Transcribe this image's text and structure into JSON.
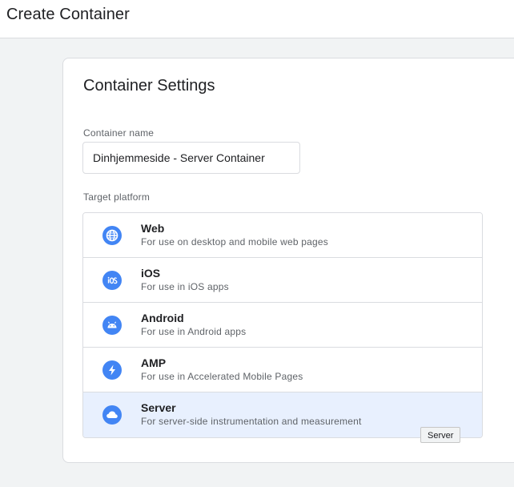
{
  "header": {
    "title": "Create Container"
  },
  "card": {
    "title": "Container Settings",
    "container_name_label": "Container name",
    "container_name_value": "Dinhjemmeside - Server Container",
    "target_platform_label": "Target platform"
  },
  "platforms": [
    {
      "name": "Web",
      "description": "For use on desktop and mobile web pages",
      "icon": "globe-icon",
      "selected": false
    },
    {
      "name": "iOS",
      "description": "For use in iOS apps",
      "icon": "ios-icon",
      "selected": false
    },
    {
      "name": "Android",
      "description": "For use in Android apps",
      "icon": "android-icon",
      "selected": false
    },
    {
      "name": "AMP",
      "description": "For use in Accelerated Mobile Pages",
      "icon": "lightning-icon",
      "selected": false
    },
    {
      "name": "Server",
      "description": "For server-side instrumentation and measurement",
      "icon": "cloud-icon",
      "selected": true
    }
  ],
  "tooltip": {
    "text": "Server"
  },
  "colors": {
    "accent": "#4285f4",
    "selected_bg": "#e8f0fe",
    "page_bg": "#f1f3f4"
  }
}
